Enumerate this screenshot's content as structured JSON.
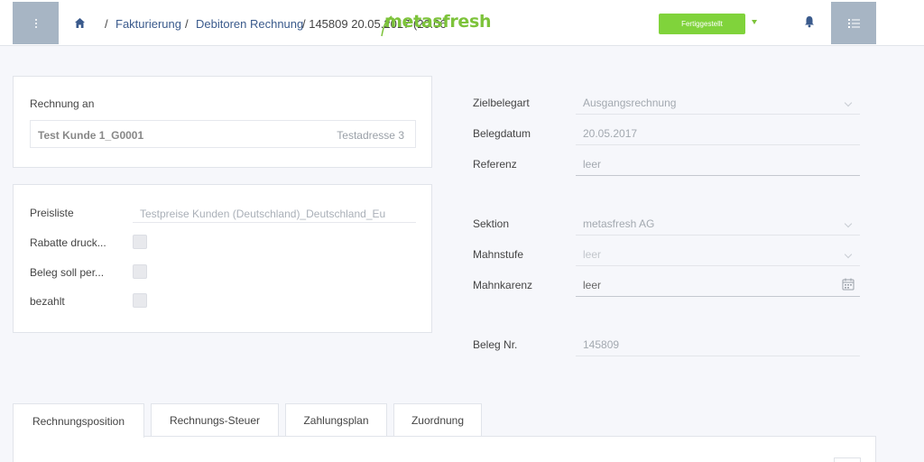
{
  "header": {
    "breadcrumb": {
      "sep1": "/",
      "item1": "Fakturierung",
      "sep2": "/",
      "item2": "Debitoren Rechnung",
      "item3": "/ 145809 20.05.2017 (20.06"
    },
    "logo_text": "metasfresh",
    "status_label": "Fertiggestellt"
  },
  "billing": {
    "label": "Rechnung an",
    "partner": "Test Kunde 1_G0001",
    "address": "Testadresse 3"
  },
  "pricing": {
    "pricelist_label": "Preisliste",
    "pricelist_value": "Testpreise Kunden (Deutschland)_Deutschland_Eu",
    "checkboxes": [
      {
        "label": "Rabatte druck..."
      },
      {
        "label": "Beleg soll per..."
      },
      {
        "label": "bezahlt"
      }
    ]
  },
  "form": {
    "zielbelegart_label": "Zielbelegart",
    "zielbelegart_value": "Ausgangsrechnung",
    "belegdatum_label": "Belegdatum",
    "belegdatum_value": "20.05.2017",
    "referenz_label": "Referenz",
    "referenz_value": "leer",
    "sektion_label": "Sektion",
    "sektion_value": "metasfresh AG",
    "mahnstufe_label": "Mahnstufe",
    "mahnstufe_value": "leer",
    "mahnkarenz_label": "Mahnkarenz",
    "mahnkarenz_value": "leer",
    "belegnr_label": "Beleg Nr.",
    "belegnr_value": "145809"
  },
  "tabs": [
    {
      "label": "Rechnungsposition"
    },
    {
      "label": "Rechnungs-Steuer"
    },
    {
      "label": "Zahlungsplan"
    },
    {
      "label": "Zuordnung"
    }
  ],
  "colors": {
    "accent_green": "#80d33b",
    "header_button": "#a7b5c4",
    "link_blue": "#3a5a8c"
  }
}
